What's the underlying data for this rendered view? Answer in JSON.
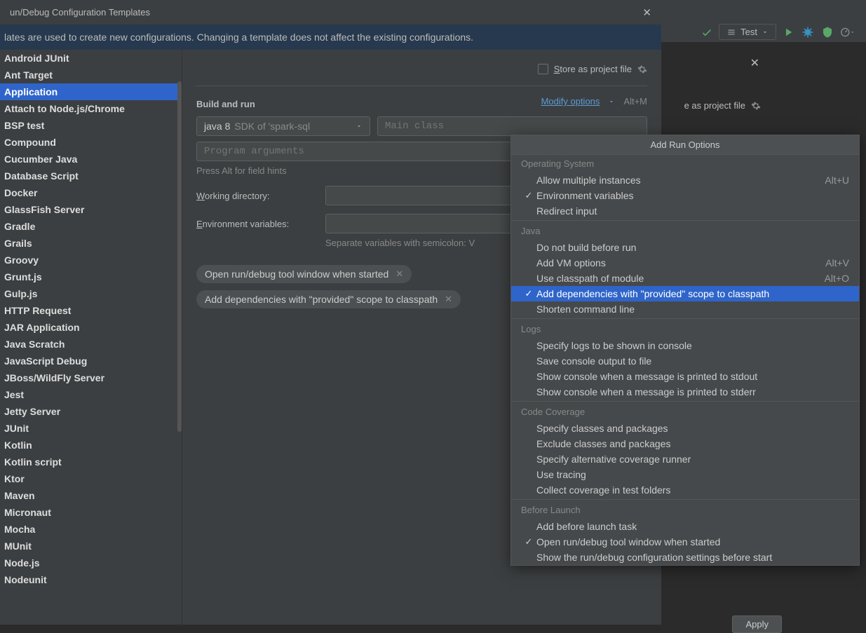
{
  "bg": {
    "test_label": "Test",
    "store_label": "e as project file"
  },
  "dialog": {
    "title": "un/Debug Configuration Templates",
    "banner": "lates are used to create new configurations. Changing a template does not affect the existing configurations.",
    "sidebar": [
      "Android JUnit",
      "Ant Target",
      "Application",
      "Attach to Node.js/Chrome",
      "BSP test",
      "Compound",
      "Cucumber Java",
      "Database Script",
      "Docker",
      "GlassFish Server",
      "Gradle",
      "Grails",
      "Groovy",
      "Grunt.js",
      "Gulp.js",
      "HTTP Request",
      "JAR Application",
      "Java Scratch",
      "JavaScript Debug",
      "JBoss/WildFly Server",
      "Jest",
      "Jetty Server",
      "JUnit",
      "Kotlin",
      "Kotlin script",
      "Ktor",
      "Maven",
      "Micronaut",
      "Mocha",
      "MUnit",
      "Node.js",
      "Nodeunit"
    ],
    "selected_sidebar_index": 2,
    "store_label": "Store as project file",
    "section_build_run": "Build and run",
    "modify_label": "Modify options",
    "modify_shortcut": "Alt+M",
    "sdk_prefix": "java 8",
    "sdk_rest": " SDK of 'spark-sql",
    "main_class_placeholder": "Main class",
    "program_args_placeholder": "Program arguments",
    "hint": "Press Alt for field hints",
    "working_dir_label": "Working directory:",
    "env_label": "Environment variables:",
    "sep_hint": "Separate variables with semicolon: V",
    "chips": [
      "Open run/debug tool window when started",
      "Add dependencies with \"provided\" scope to classpath"
    ],
    "apply_label": "Apply"
  },
  "popup": {
    "title": "Add Run Options",
    "groups": [
      {
        "label": "Operating System",
        "items": [
          {
            "label": "Allow multiple instances",
            "shortcut": "Alt+U",
            "checked": false
          },
          {
            "label": "Environment variables",
            "checked": true
          },
          {
            "label": "Redirect input",
            "checked": false
          }
        ]
      },
      {
        "label": "Java",
        "items": [
          {
            "label": "Do not build before run",
            "checked": false
          },
          {
            "label": "Add VM options",
            "shortcut": "Alt+V",
            "checked": false
          },
          {
            "label": "Use classpath of module",
            "shortcut": "Alt+O",
            "checked": false
          },
          {
            "label": "Add dependencies with \"provided\" scope to classpath",
            "checked": true,
            "selected": true
          },
          {
            "label": "Shorten command line",
            "checked": false
          }
        ]
      },
      {
        "label": "Logs",
        "items": [
          {
            "label": "Specify logs to be shown in console",
            "checked": false
          },
          {
            "label": "Save console output to file",
            "checked": false
          },
          {
            "label": "Show console when a message is printed to stdout",
            "checked": false
          },
          {
            "label": "Show console when a message is printed to stderr",
            "checked": false
          }
        ]
      },
      {
        "label": "Code Coverage",
        "items": [
          {
            "label": "Specify classes and packages",
            "checked": false
          },
          {
            "label": "Exclude classes and packages",
            "checked": false
          },
          {
            "label": "Specify alternative coverage runner",
            "checked": false
          },
          {
            "label": "Use tracing",
            "checked": false
          },
          {
            "label": "Collect coverage in test folders",
            "checked": false
          }
        ]
      },
      {
        "label": "Before Launch",
        "items": [
          {
            "label": "Add before launch task",
            "checked": false
          },
          {
            "label": "Open run/debug tool window when started",
            "checked": true
          },
          {
            "label": "Show the run/debug configuration settings before start",
            "checked": false
          }
        ]
      }
    ]
  }
}
